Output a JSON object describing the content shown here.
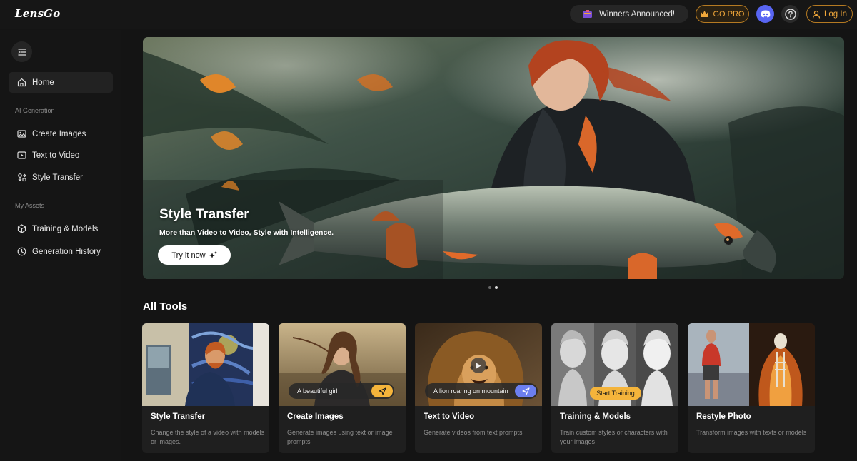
{
  "header": {
    "logo": "LensGo",
    "winners": "Winners Announced!",
    "gopro": "GO PRO",
    "login": "Log In"
  },
  "sidebar": {
    "home": "Home",
    "section_ai": "AI Generation",
    "create_images": "Create Images",
    "text_to_video": "Text to Video",
    "style_transfer": "Style Transfer",
    "section_assets": "My Assets",
    "training_models": "Training & Models",
    "generation_history": "Generation History"
  },
  "hero": {
    "title": "Style Transfer",
    "subtitle": "More than Video to Video, Style with Intelligence.",
    "button": "Try it now"
  },
  "tools": {
    "heading": "All Tools",
    "cards": [
      {
        "title": "Style Transfer",
        "desc": "Change the style of a video with models or images."
      },
      {
        "title": "Create Images",
        "desc": "Generate images using text or image prompts",
        "prompt": "A beautiful girl"
      },
      {
        "title": "Text to Video",
        "desc": "Generate videos from text prompts",
        "prompt": "A lion roaring on mountain"
      },
      {
        "title": "Training & Models",
        "desc": "Train custom styles or characters with your images",
        "badge": "Start Training"
      },
      {
        "title": "Restyle Photo",
        "desc": "Transform images with texts or models"
      }
    ]
  },
  "colors": {
    "accent": "#f0a73a",
    "discord": "#5865f2",
    "background": "#141414"
  }
}
